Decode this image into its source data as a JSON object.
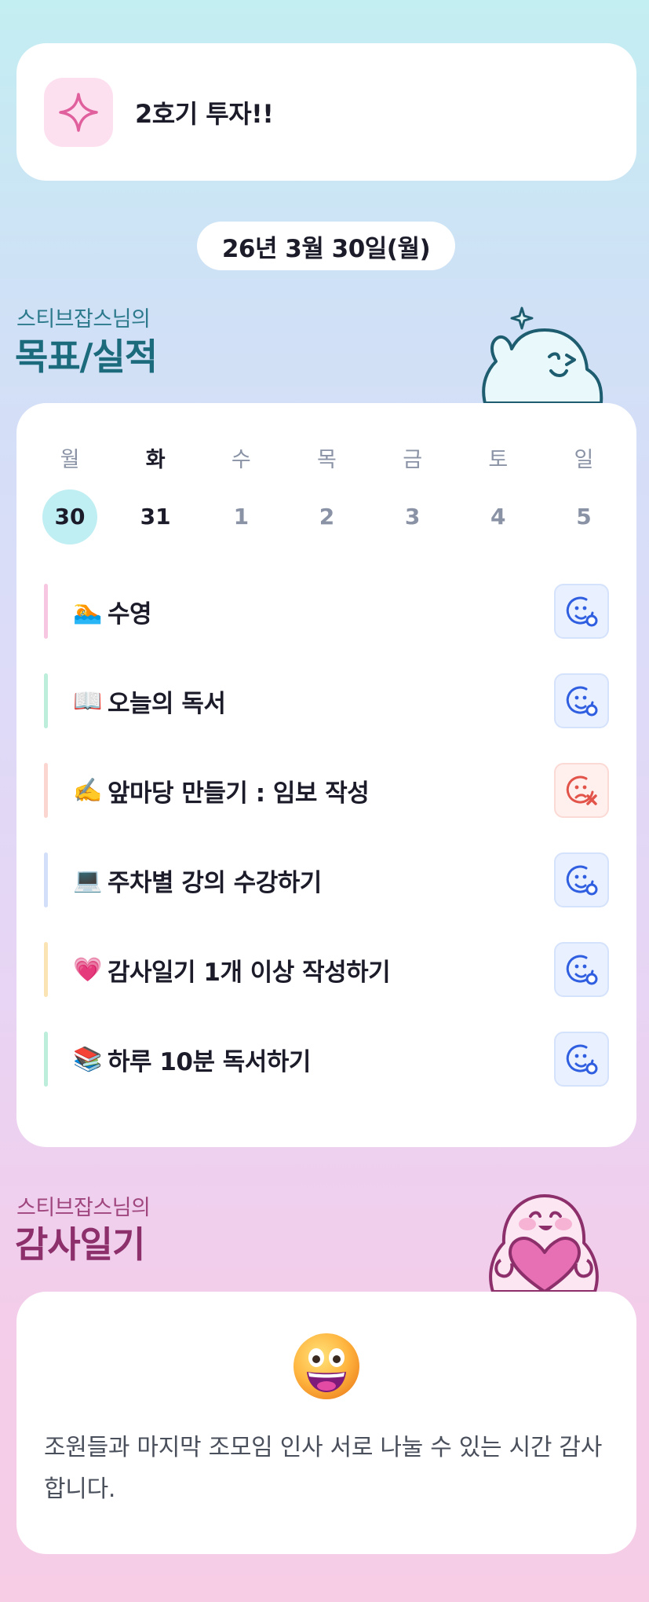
{
  "notice": {
    "text": "2호기 투자!!",
    "icon": "sparkle-icon"
  },
  "date_label": "26년 3월 30일(월)",
  "goals_section": {
    "subtitle": "스티브잡스님의",
    "title": "목표/실적"
  },
  "week": {
    "weekdays": [
      "월",
      "화",
      "수",
      "목",
      "금",
      "토",
      "일"
    ],
    "dates": [
      "30",
      "31",
      "1",
      "2",
      "3",
      "4",
      "5"
    ],
    "selected_index": 0,
    "today_index": 1
  },
  "goals": [
    {
      "emoji": "🏊",
      "text": "수영",
      "bar_color": "#f7c6e0",
      "status": "done",
      "status_icon": "smile-check-icon"
    },
    {
      "emoji": "📖",
      "text": "오늘의 독서",
      "bar_color": "#bdeedb",
      "status": "done",
      "status_icon": "smile-check-icon"
    },
    {
      "emoji": "✍️",
      "text": "앞마당 만들기 : 임보 작성",
      "bar_color": "#fbd6d0",
      "status": "failed",
      "status_icon": "sad-x-icon"
    },
    {
      "emoji": "💻",
      "text": "주차별 강의 수강하기",
      "bar_color": "#d3dff8",
      "status": "done",
      "status_icon": "smile-check-icon"
    },
    {
      "emoji": "💗",
      "text": "감사일기 1개 이상 작성하기",
      "bar_color": "#fbe4b3",
      "status": "done",
      "status_icon": "smile-check-icon"
    },
    {
      "emoji": "📚",
      "text": "하루 10분 독서하기",
      "bar_color": "#bdeedb",
      "status": "done",
      "status_icon": "smile-check-icon"
    }
  ],
  "diary_section": {
    "subtitle": "스티브잡스님의",
    "title": "감사일기"
  },
  "diary": {
    "emoji_icon": "grinning-face-icon",
    "text": "조원들과 마지막 조모임 인사 서로 나눌 수 있는 시간 감사합니다."
  },
  "colors": {
    "accent_teal": "#1b6b7d",
    "accent_pink": "#8c2f6b",
    "ok_blue": "#2f5fe0",
    "fail_red": "#e2544a"
  }
}
